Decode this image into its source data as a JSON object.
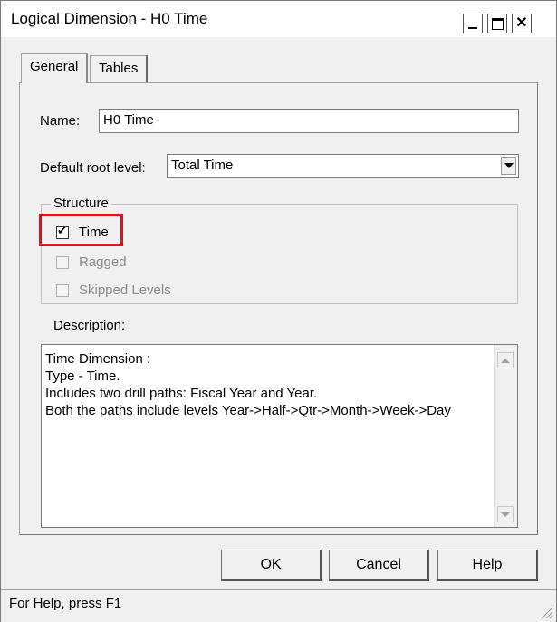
{
  "window": {
    "title": "Logical Dimension - H0 Time",
    "controls": {
      "minimize": "minimize",
      "maximize": "maximize",
      "close": "✕"
    }
  },
  "tabs": [
    {
      "label": "General",
      "active": true
    },
    {
      "label": "Tables",
      "active": false
    }
  ],
  "general": {
    "name_label": "Name:",
    "name_value": "H0 Time",
    "root_level_label": "Default root level:",
    "root_level_value": "Total Time",
    "structure": {
      "legend": "Structure",
      "options": [
        {
          "label": "Time",
          "checked": true,
          "enabled": true
        },
        {
          "label": "Ragged",
          "checked": false,
          "enabled": false
        },
        {
          "label": "Skipped Levels",
          "checked": false,
          "enabled": false
        }
      ]
    },
    "description_label": "Description:",
    "description_text": "Time Dimension :\nType - Time.\nIncludes two drill paths: Fiscal Year and Year.\nBoth the paths include levels Year->Half->Qtr->Month->Week->Day"
  },
  "buttons": {
    "ok": "OK",
    "cancel": "Cancel",
    "help": "Help"
  },
  "status": {
    "text": "For Help, press F1"
  },
  "colors": {
    "highlight": "#d9141d",
    "dialog_bg": "#f0f0f0"
  }
}
